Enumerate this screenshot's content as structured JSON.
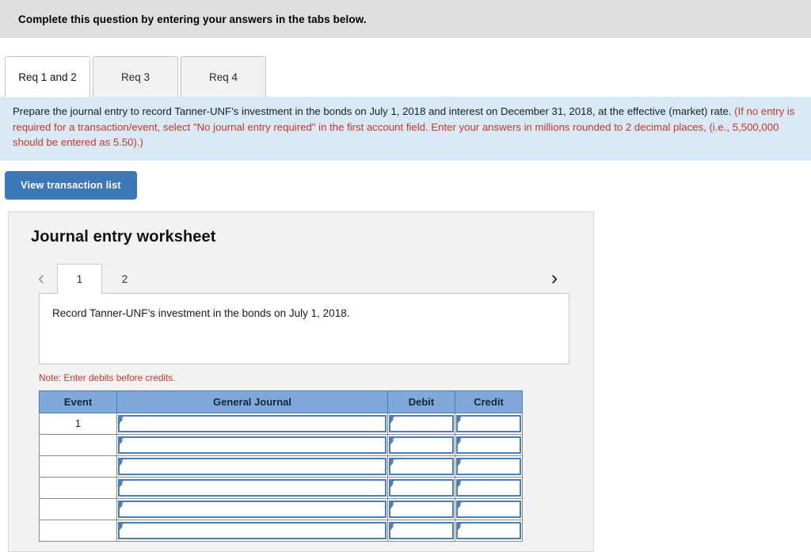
{
  "banner": {
    "text": "Complete this question by entering your answers in the tabs below."
  },
  "tabs": [
    {
      "label": "Req 1 and 2",
      "active": true
    },
    {
      "label": "Req 3",
      "active": false
    },
    {
      "label": "Req 4",
      "active": false
    }
  ],
  "instruction": {
    "black_text": "Prepare the journal entry to record Tanner-UNF’s investment in the bonds on July 1, 2018 and interest on December 31, 2018, at the effective (market) rate. ",
    "red_text": "(If no entry is required for a transaction/event, select \"No journal entry required\" in the first account field. Enter your answers in millions rounded to 2 decimal places, (i.e., 5,500,000 should be entered as 5.50).)"
  },
  "toolbar": {
    "view_transaction_list_label": "View transaction list"
  },
  "worksheet": {
    "title": "Journal entry worksheet",
    "prev_icon": "chevron-left-icon",
    "next_icon": "chevron-right-icon",
    "pages": [
      {
        "label": "1",
        "active": true
      },
      {
        "label": "2",
        "active": false
      }
    ],
    "description": "Record Tanner-UNF’s investment in the bonds on July 1, 2018.",
    "note": "Note: Enter debits before credits.",
    "table": {
      "headers": [
        "Event",
        "General Journal",
        "Debit",
        "Credit"
      ],
      "rows": [
        {
          "event": "1",
          "general_journal": "",
          "debit": "",
          "credit": ""
        },
        {
          "event": "",
          "general_journal": "",
          "debit": "",
          "credit": ""
        },
        {
          "event": "",
          "general_journal": "",
          "debit": "",
          "credit": ""
        },
        {
          "event": "",
          "general_journal": "",
          "debit": "",
          "credit": ""
        },
        {
          "event": "",
          "general_journal": "",
          "debit": "",
          "credit": ""
        },
        {
          "event": "",
          "general_journal": "",
          "debit": "",
          "credit": ""
        }
      ]
    }
  },
  "colors": {
    "banner_bg": "#dedede",
    "instruction_bg": "#d9e8f5",
    "accent_blue": "#3c77b8",
    "table_header_blue": "#7fa9d8",
    "field_border_blue": "#4a7ebb",
    "red_text": "#c0392b",
    "panel_bg": "#f2f2f2"
  }
}
